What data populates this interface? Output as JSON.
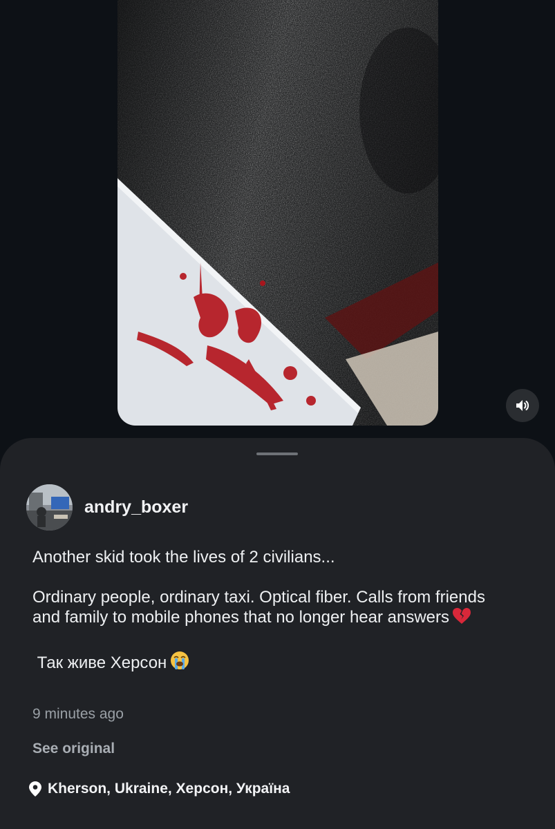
{
  "post": {
    "username": "andry_boxer",
    "caption": [
      "Another skid took the lives of 2 civilians...",
      "Ordinary people, ordinary taxi. Optical fiber. Calls from friends and family to mobile phones that no longer hear answers",
      " Так живе Херсон"
    ],
    "caption_emojis": [
      "broken-heart",
      "loudly-crying-face"
    ],
    "timestamp": "9 minutes ago",
    "see_original": "See original",
    "location": "Kherson, Ukraine, Херсон, Україна"
  },
  "video": {
    "muted": false,
    "sound_icon": "speaker-icon"
  },
  "colors": {
    "background": "#0d1116",
    "sheet": "#202226",
    "text": "#f2f3f5",
    "muted_text": "#9aa0a6"
  }
}
